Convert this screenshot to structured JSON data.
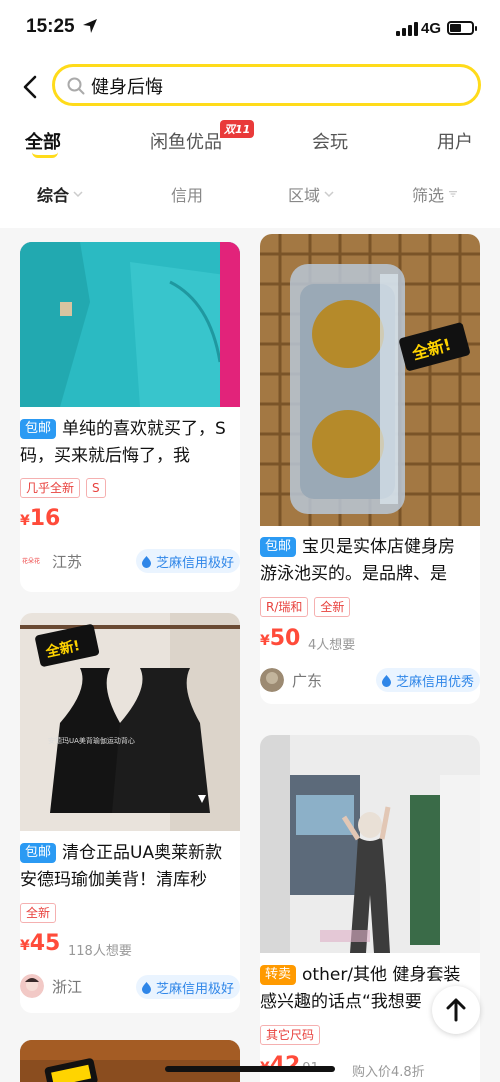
{
  "status": {
    "time": "15:25",
    "network": "4G"
  },
  "search": {
    "query": "健身后悔"
  },
  "tabs": [
    {
      "label": "全部"
    },
    {
      "label": "闲鱼优品",
      "badge": "双11"
    },
    {
      "label": "会玩"
    },
    {
      "label": "用户"
    }
  ],
  "filters": [
    {
      "label": "综合"
    },
    {
      "label": "信用"
    },
    {
      "label": "区域"
    },
    {
      "label": "筛选"
    }
  ],
  "items": [
    {
      "ship_tag": "包邮",
      "title": "单纯的喜欢就买了，S码，买来就后悔了，我",
      "chips": [
        "几乎全新",
        "S"
      ],
      "price_symbol": "¥",
      "price": "16",
      "wants": "",
      "region": "江苏",
      "credit": "芝麻信用极好"
    },
    {
      "ship_tag": "包邮",
      "title": "宝贝是实体店健身房游泳池买的。是品牌、是",
      "chips": [
        "R/瑞和",
        "全新"
      ],
      "price_symbol": "¥",
      "price": "50",
      "wants": "4人想要",
      "region": "广东",
      "credit": "芝麻信用优秀",
      "image_badge": "全新!"
    },
    {
      "ship_tag": "包邮",
      "title": "清仓正品UA奥莱新款安德玛瑜伽美背！清库秒",
      "chips": [
        "全新"
      ],
      "price_symbol": "¥",
      "price": "45",
      "wants": "118人想要",
      "region": "浙江",
      "credit": "芝麻信用极好",
      "image_badge": "全新!"
    },
    {
      "ship_tag": "转卖",
      "title": "other/其他 健身套装感兴趣的话点“我想要",
      "chips": [
        "其它尺码"
      ],
      "price_symbol": "¥",
      "price": "42",
      "price_suffix": "91",
      "wants": "购入价4.8折"
    }
  ],
  "colors": {
    "accent": "#ffdb1a",
    "price": "#ff4b3a",
    "ship": "#2b9af3",
    "resale": "#ff9a00"
  }
}
